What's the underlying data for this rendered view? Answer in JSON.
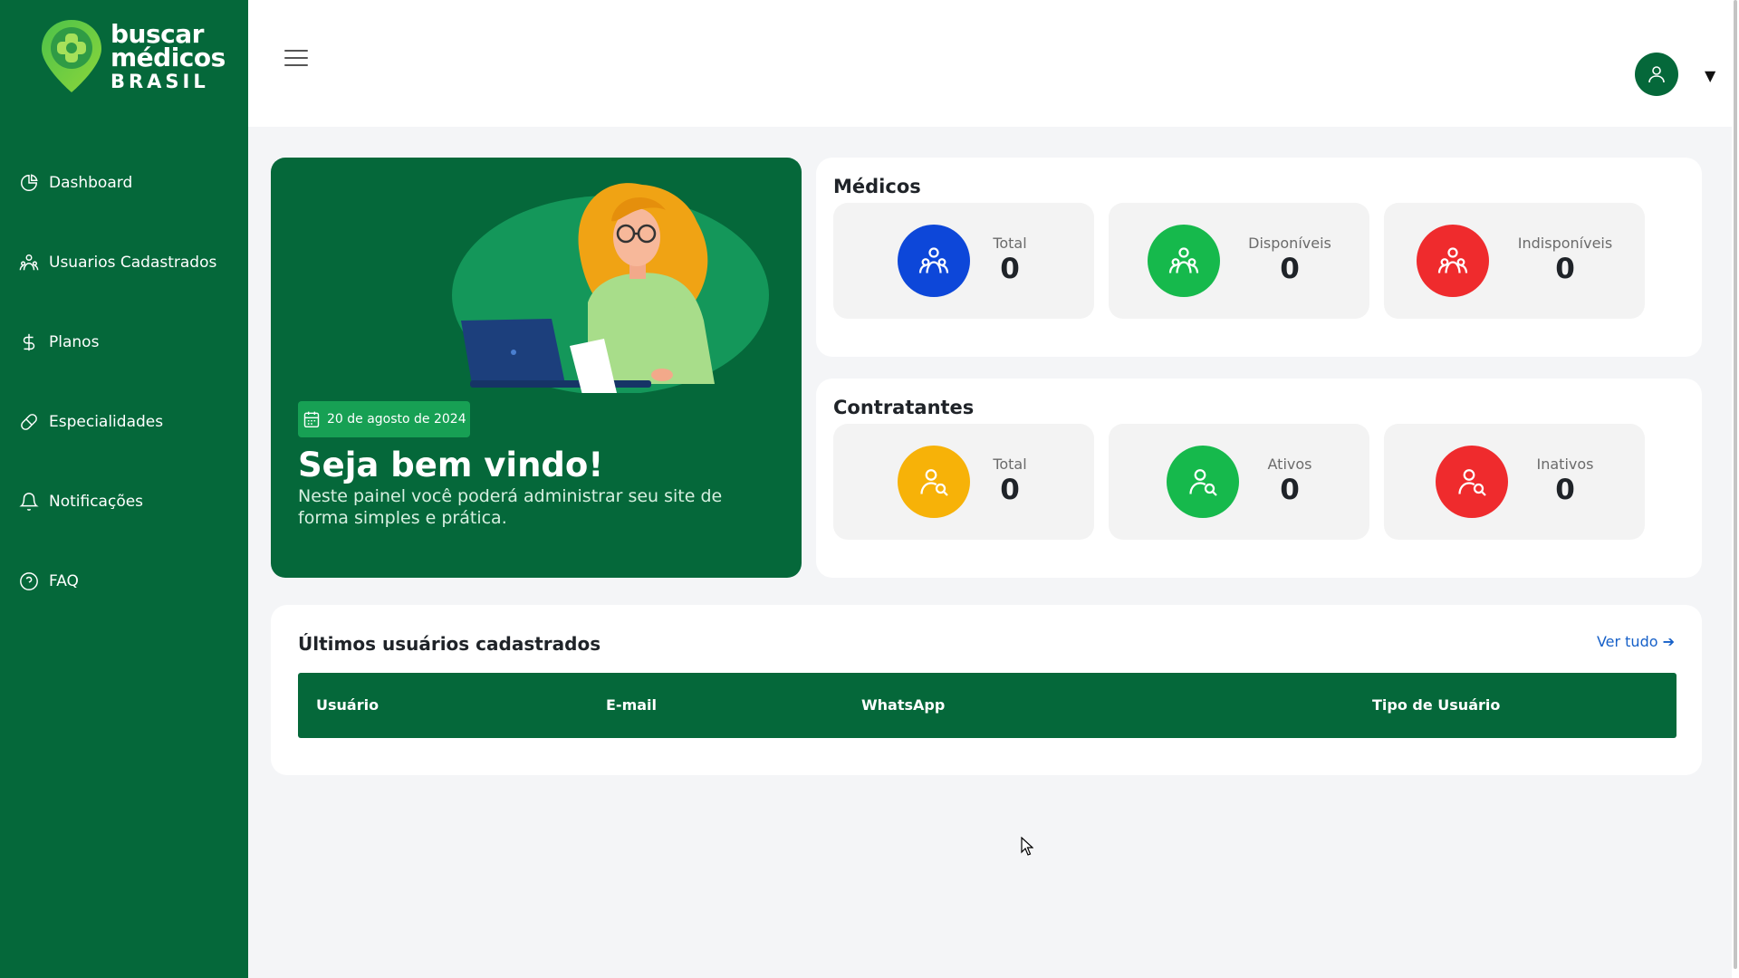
{
  "brand": {
    "line1": "buscar",
    "line2": "médicos",
    "line3": "BRASIL",
    "primary_color": "#05683a",
    "accent_color": "#17a054"
  },
  "sidebar": {
    "items": [
      {
        "label": "Dashboard",
        "icon": "pie-chart-icon"
      },
      {
        "label": "Usuarios Cadastrados",
        "icon": "users-icon"
      },
      {
        "label": "Planos",
        "icon": "dollar-icon"
      },
      {
        "label": "Especialidades",
        "icon": "pill-icon"
      },
      {
        "label": "Notificações",
        "icon": "bell-icon"
      },
      {
        "label": "FAQ",
        "icon": "question-circle-icon"
      }
    ]
  },
  "header": {
    "menu_icon": "hamburger-icon",
    "user_icon": "user-icon",
    "dropdown_glyph": "▼"
  },
  "welcome": {
    "date": "20 de agosto de 2024",
    "title": "Seja bem vindo!",
    "subtitle": "Neste painel você poderá administrar seu site de forma simples e prática."
  },
  "medicos": {
    "title": "Médicos",
    "stats": [
      {
        "label": "Total",
        "value": "0",
        "color": "#0d47d9",
        "icon": "users-icon"
      },
      {
        "label": "Disponíveis",
        "value": "0",
        "color": "#16b94c",
        "icon": "users-icon"
      },
      {
        "label": "Indisponíveis",
        "value": "0",
        "color": "#ef2b2d",
        "icon": "users-icon"
      }
    ]
  },
  "contratantes": {
    "title": "Contratantes",
    "stats": [
      {
        "label": "Total",
        "value": "0",
        "color": "#f7b208",
        "icon": "user-search-icon"
      },
      {
        "label": "Ativos",
        "value": "0",
        "color": "#16b94c",
        "icon": "user-search-icon"
      },
      {
        "label": "Inativos",
        "value": "0",
        "color": "#ef2b2d",
        "icon": "user-search-icon"
      }
    ]
  },
  "latest_users": {
    "title": "Últimos usuários cadastrados",
    "view_all": "Ver tudo ➔",
    "columns": [
      "Usuário",
      "E-mail",
      "WhatsApp",
      "Tipo de Usuário"
    ],
    "rows": []
  }
}
